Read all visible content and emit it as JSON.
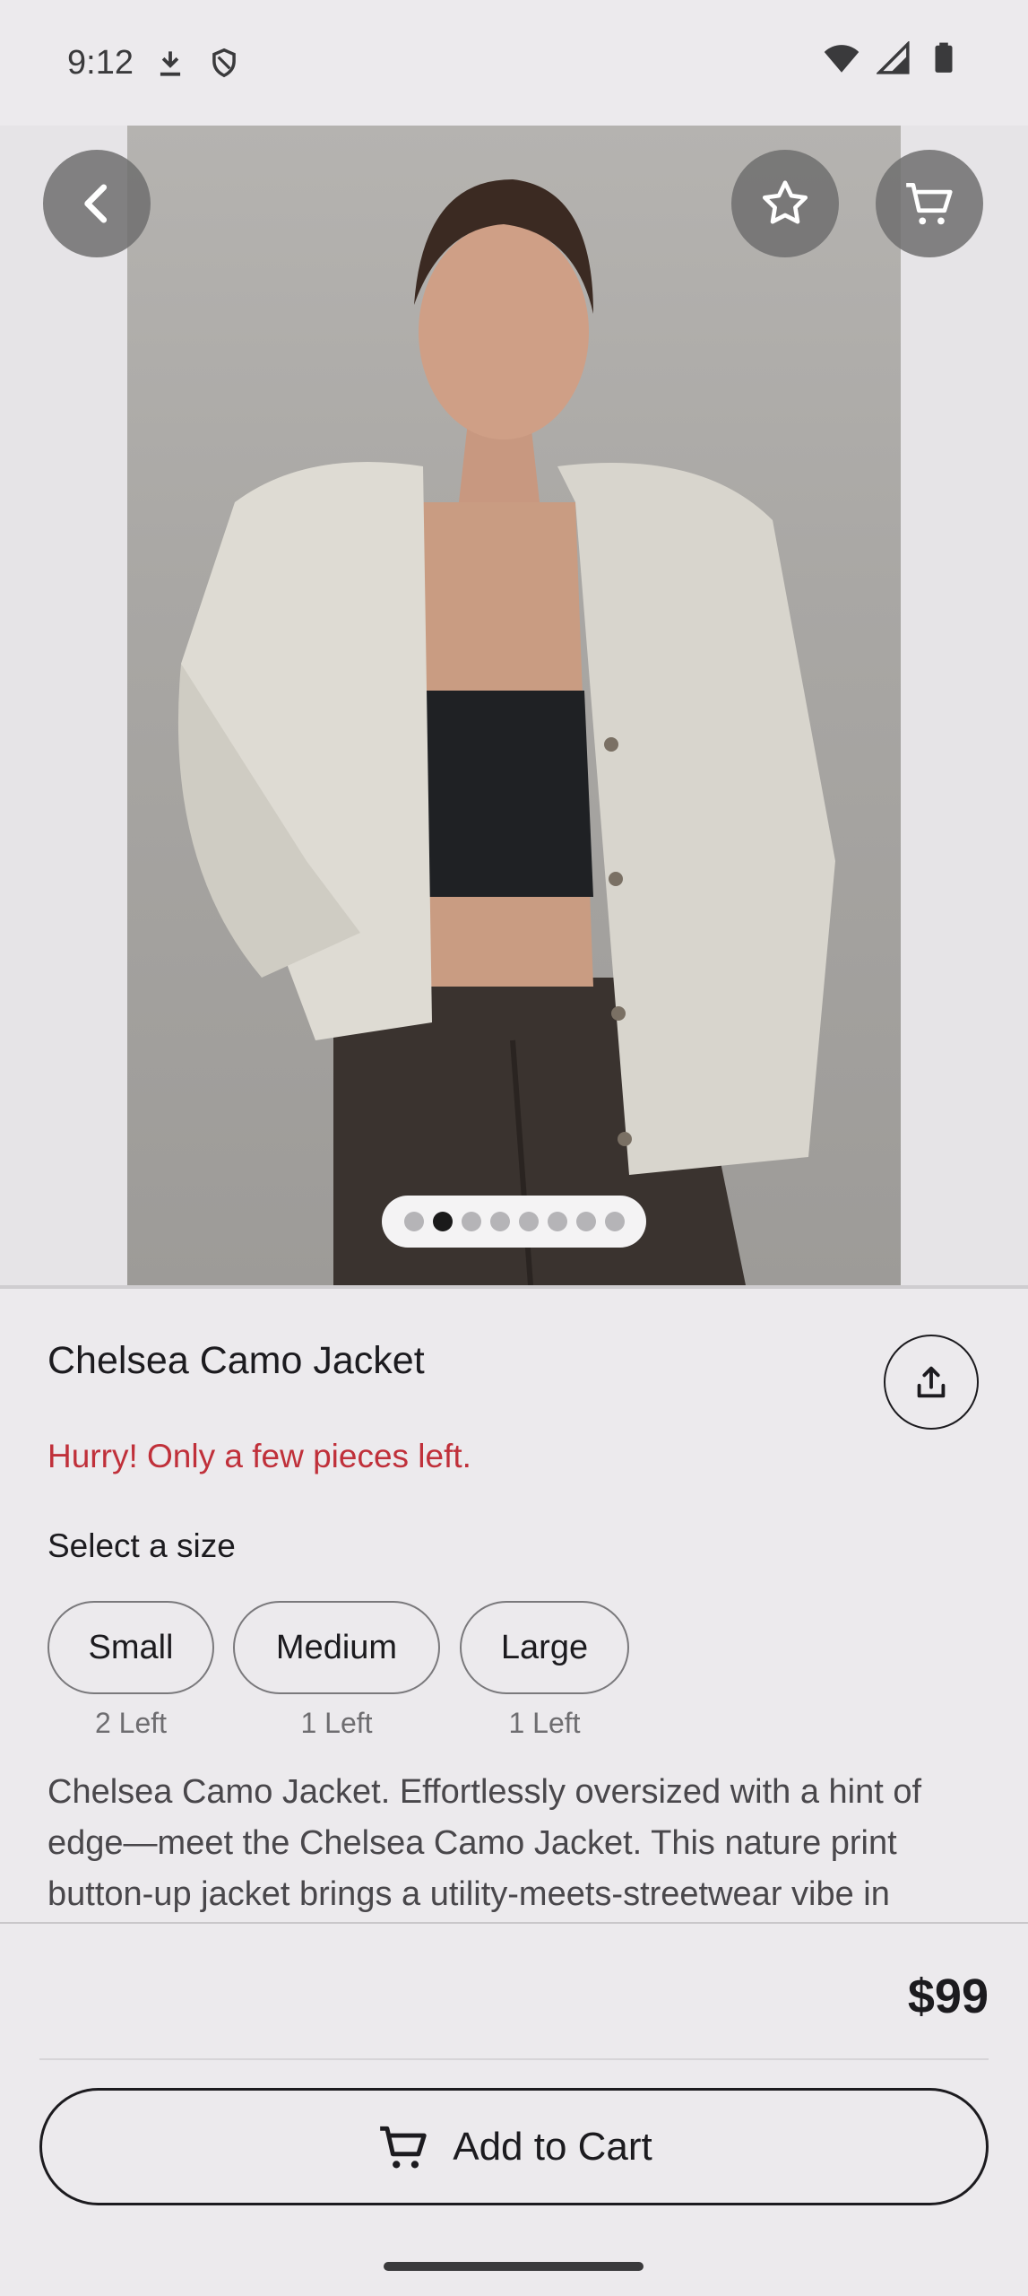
{
  "status_bar": {
    "time": "9:12",
    "left_icons": [
      "download-icon",
      "shield-icon"
    ],
    "right_icons": [
      "wifi-icon",
      "signal-icon",
      "battery-icon"
    ]
  },
  "hero": {
    "image_description_icon": "product-photo",
    "pager": {
      "count": 8,
      "active_index": 1
    }
  },
  "top_actions": {
    "back_icon": "chevron-left-icon",
    "favorite_icon": "star-icon",
    "cart_icon": "cart-icon"
  },
  "product": {
    "title": "Chelsea Camo Jacket",
    "urgency": "Hurry! Only a few pieces left.",
    "size_label": "Select a size",
    "sizes": [
      {
        "label": "Small",
        "left": "2 Left"
      },
      {
        "label": "Medium",
        "left": "1 Left"
      },
      {
        "label": "Large",
        "left": "1 Left"
      }
    ],
    "description": "Chelsea Camo Jacket. Effortlessly oversized with a hint of edge—meet the Chelsea Camo Jacket. This nature print button-up jacket brings a utility-meets-streetwear vibe in"
  },
  "footer": {
    "price": "$99",
    "add_to_cart_label": "Add to Cart"
  },
  "colors": {
    "background": "#eceaed",
    "urgency": "#c0303a",
    "overlay_button": "#6e6e6e"
  }
}
